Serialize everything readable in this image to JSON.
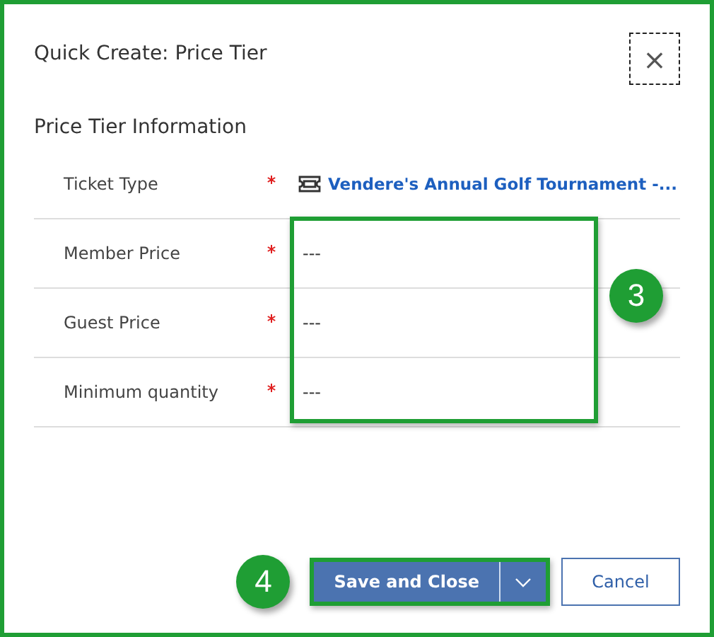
{
  "dialog": {
    "title": "Quick Create: Price Tier",
    "close": "×"
  },
  "section": {
    "title": "Price Tier Information"
  },
  "fields": [
    {
      "label": "Ticket Type",
      "required": true,
      "kind": "lookup",
      "value": "Vendere's Annual Golf Tournament -..."
    },
    {
      "label": "Member Price",
      "required": true,
      "kind": "text",
      "value": "---"
    },
    {
      "label": "Guest Price",
      "required": true,
      "kind": "text",
      "value": "---"
    },
    {
      "label": "Minimum quantity",
      "required": true,
      "kind": "text",
      "value": "---"
    }
  ],
  "callouts": [
    {
      "label": "3"
    },
    {
      "label": "4"
    }
  ],
  "buttons": {
    "save": "Save and Close",
    "cancel": "Cancel"
  }
}
